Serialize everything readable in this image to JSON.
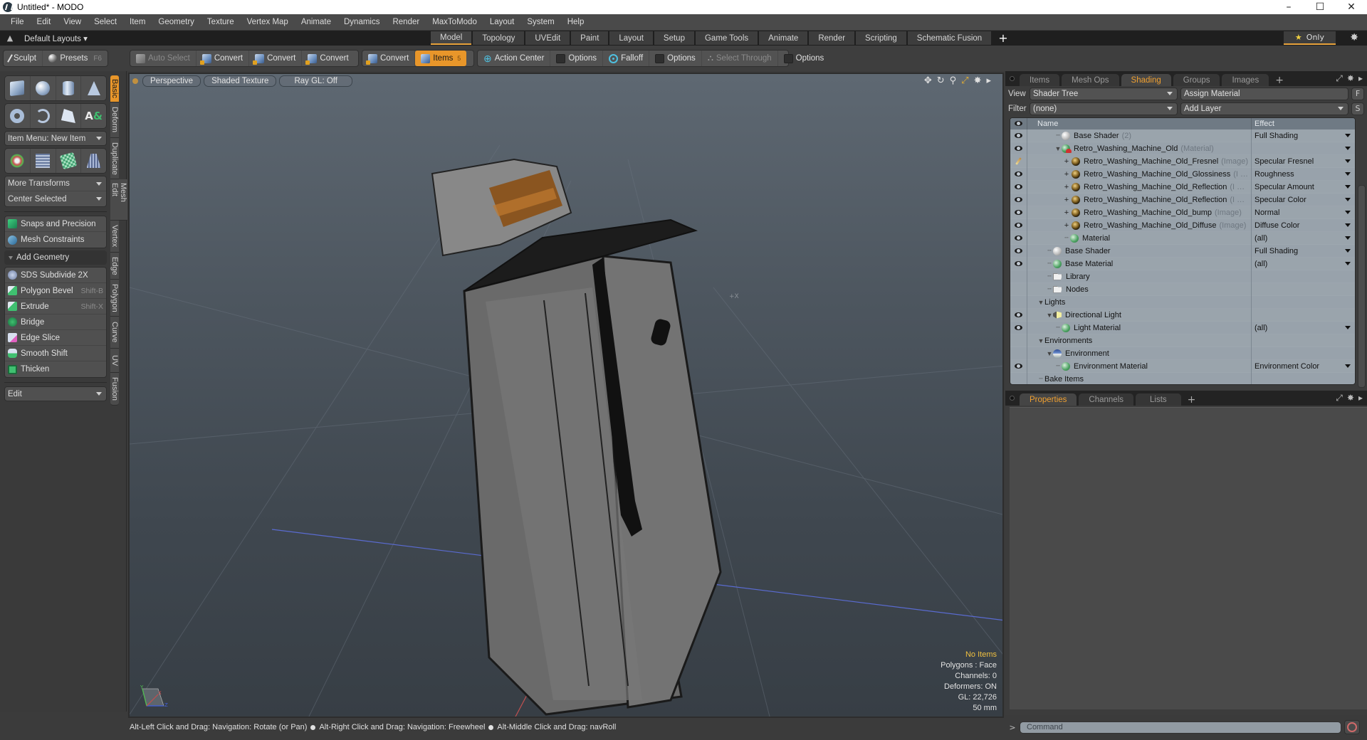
{
  "window": {
    "title": "Untitled* - MODO",
    "controls": {
      "minimize": "–",
      "maximize": "☐",
      "close": "✕"
    }
  },
  "menubar": {
    "items": [
      "File",
      "Edit",
      "View",
      "Select",
      "Item",
      "Geometry",
      "Texture",
      "Vertex Map",
      "Animate",
      "Dynamics",
      "Render",
      "MaxToModo",
      "Layout",
      "System",
      "Help"
    ]
  },
  "layoutbar": {
    "default_layouts": "Default Layouts ▾",
    "tabs": [
      "Model",
      "Topology",
      "UVEdit",
      "Paint",
      "Layout",
      "Setup",
      "Game Tools",
      "Animate",
      "Render",
      "Scripting",
      "Schematic Fusion"
    ],
    "active_tab": "Model",
    "add": "+",
    "only_label": "Only",
    "only_icon": "star-icon",
    "settings_icon": "gear-icon"
  },
  "toolbar": {
    "sculpt": "Sculpt",
    "presets": "Presets",
    "presets_key": "F6",
    "auto_select": "Auto Select",
    "convert1": "Convert",
    "convert2": "Convert",
    "convert3": "Convert",
    "convert4": "Convert",
    "items": "Items",
    "items_badge": "5",
    "action_center": "Action Center",
    "options1": "Options",
    "falloff": "Falloff",
    "options2": "Options",
    "select_through": "Select Through",
    "options3": "Options"
  },
  "leftpanel": {
    "primitives_row1": [
      "cube-icon",
      "sphere-icon",
      "cylinder-icon",
      "cone-icon"
    ],
    "primitives_row2": [
      "torus-icon",
      "spiral-icon",
      "pen-icon",
      "text-icon"
    ],
    "item_menu": "Item Menu: New Item",
    "transforms_row": [
      "transform-gizmo-icon",
      "mesh-grid-icon",
      "checker-cube-icon",
      "trapezoid-icon"
    ],
    "more_transforms": "More Transforms",
    "center_selected": "Center Selected",
    "snaps": "Snaps and Precision",
    "mesh_constraints": "Mesh Constraints",
    "add_geometry": "Add Geometry",
    "tools": [
      {
        "label": "SDS Subdivide 2X",
        "shortcut": ""
      },
      {
        "label": "Polygon Bevel",
        "shortcut": "Shift-B"
      },
      {
        "label": "Extrude",
        "shortcut": "Shift-X"
      },
      {
        "label": "Bridge",
        "shortcut": ""
      },
      {
        "label": "Edge Slice",
        "shortcut": ""
      },
      {
        "label": "Smooth Shift",
        "shortcut": ""
      },
      {
        "label": "Thicken",
        "shortcut": ""
      }
    ],
    "edit_dropdown": "Edit",
    "vertical_tabs": [
      "Basic",
      "Deform",
      "Duplicate",
      "Mesh Edit",
      "Vertex",
      "Edge",
      "Polygon",
      "Curve",
      "UV",
      "Fusion"
    ],
    "active_vertical_tab": "Basic"
  },
  "viewport": {
    "view": "Perspective",
    "shading": "Shaded Texture",
    "raygl": "Ray GL: Off",
    "stats": {
      "selection": "No Items",
      "polygons": "Polygons : Face",
      "channels": "Channels: 0",
      "deformers": "Deformers: ON",
      "gl": "GL: 22,726",
      "scale": "50 mm"
    },
    "axis_labels": {
      "x": "X",
      "y": "Y",
      "z": "Z"
    }
  },
  "statusbar": {
    "hint1": "Alt-Left Click and Drag: Navigation: Rotate (or Pan)",
    "hint2": "Alt-Right Click and Drag: Navigation: Freewheel",
    "hint3": "Alt-Middle Click and Drag: navRoll"
  },
  "rightpanel": {
    "tabs": [
      "Items",
      "Mesh Ops",
      "Shading",
      "Groups",
      "Images"
    ],
    "active_tab": "Shading",
    "view_label": "View",
    "view_value": "Shader Tree",
    "assign_material": "Assign Material",
    "f_btn": "F",
    "filter_label": "Filter",
    "filter_value": "(none)",
    "add_layer": "Add Layer",
    "s_btn": "S",
    "columns": {
      "name": "Name",
      "effect": "Effect"
    },
    "tree": [
      {
        "visible": "eye",
        "indent": 2,
        "twist": "",
        "icon": "white",
        "name": "Base Shader",
        "suffix": "(2)",
        "effect": "Full Shading",
        "dropdown": true
      },
      {
        "visible": "eye",
        "indent": 2,
        "twist": "▼",
        "icon": "mat",
        "name": "Retro_Washing_Machine_Old",
        "suffix": "(Material)",
        "effect": "",
        "dropdown": true
      },
      {
        "visible": "brush",
        "indent": 3,
        "twist": "+",
        "icon": "img",
        "name": "Retro_Washing_Machine_Old_Fresnel",
        "suffix": "(Image)",
        "effect": "Specular Fresnel",
        "dropdown": true
      },
      {
        "visible": "eye",
        "indent": 3,
        "twist": "+",
        "icon": "img",
        "name": "Retro_Washing_Machine_Old_Glossiness",
        "suffix": "(I …",
        "effect": "Roughness",
        "dropdown": true
      },
      {
        "visible": "eye",
        "indent": 3,
        "twist": "+",
        "icon": "img",
        "name": "Retro_Washing_Machine_Old_Reflection",
        "suffix": "(I …",
        "effect": "Specular Amount",
        "dropdown": true
      },
      {
        "visible": "eye",
        "indent": 3,
        "twist": "+",
        "icon": "img",
        "name": "Retro_Washing_Machine_Old_Reflection",
        "suffix": "(I …",
        "effect": "Specular Color",
        "dropdown": true
      },
      {
        "visible": "eye",
        "indent": 3,
        "twist": "+",
        "icon": "img",
        "name": "Retro_Washing_Machine_Old_bump",
        "suffix": "(Image)",
        "effect": "Normal",
        "dropdown": true
      },
      {
        "visible": "eye",
        "indent": 3,
        "twist": "+",
        "icon": "img",
        "name": "Retro_Washing_Machine_Old_Diffuse",
        "suffix": "(Image)",
        "effect": "Diffuse Color",
        "dropdown": true
      },
      {
        "visible": "eye",
        "indent": 3,
        "twist": "",
        "icon": "green",
        "name": "Material",
        "suffix": "",
        "effect": "(all)",
        "dropdown": true
      },
      {
        "visible": "eye",
        "indent": 1,
        "twist": "",
        "icon": "white",
        "name": "Base Shader",
        "suffix": "",
        "effect": "Full Shading",
        "dropdown": true
      },
      {
        "visible": "eye",
        "indent": 1,
        "twist": "",
        "icon": "green",
        "name": "Base Material",
        "suffix": "",
        "effect": "(all)",
        "dropdown": true
      },
      {
        "visible": "",
        "indent": 1,
        "twist": "",
        "icon": "folder",
        "name": "Library",
        "suffix": "",
        "effect": "",
        "dropdown": false
      },
      {
        "visible": "",
        "indent": 1,
        "twist": "",
        "icon": "folder",
        "name": "Nodes",
        "suffix": "",
        "effect": "",
        "dropdown": false
      },
      {
        "visible": "",
        "indent": 0,
        "twist": "▼",
        "icon": "",
        "name": "Lights",
        "suffix": "",
        "effect": "",
        "dropdown": false
      },
      {
        "visible": "eye",
        "indent": 1,
        "twist": "▼",
        "icon": "light",
        "name": "Directional Light",
        "suffix": "",
        "effect": "",
        "dropdown": false
      },
      {
        "visible": "eye",
        "indent": 2,
        "twist": "",
        "icon": "green",
        "name": "Light Material",
        "suffix": "",
        "effect": "(all)",
        "dropdown": true
      },
      {
        "visible": "",
        "indent": 0,
        "twist": "▼",
        "icon": "",
        "name": "Environments",
        "suffix": "",
        "effect": "",
        "dropdown": false
      },
      {
        "visible": "",
        "indent": 1,
        "twist": "▼",
        "icon": "env",
        "name": "Environment",
        "suffix": "",
        "effect": "",
        "dropdown": false
      },
      {
        "visible": "eye",
        "indent": 2,
        "twist": "",
        "icon": "green",
        "name": "Environment Material",
        "suffix": "",
        "effect": "Environment Color",
        "dropdown": true
      },
      {
        "visible": "",
        "indent": 0,
        "twist": "",
        "icon": "",
        "name": "Bake Items",
        "suffix": "",
        "effect": "",
        "dropdown": false
      }
    ],
    "lower_tabs": [
      "Properties",
      "Channels",
      "Lists"
    ],
    "lower_active": "Properties"
  },
  "command": {
    "prompt": ">",
    "placeholder": "Command"
  }
}
